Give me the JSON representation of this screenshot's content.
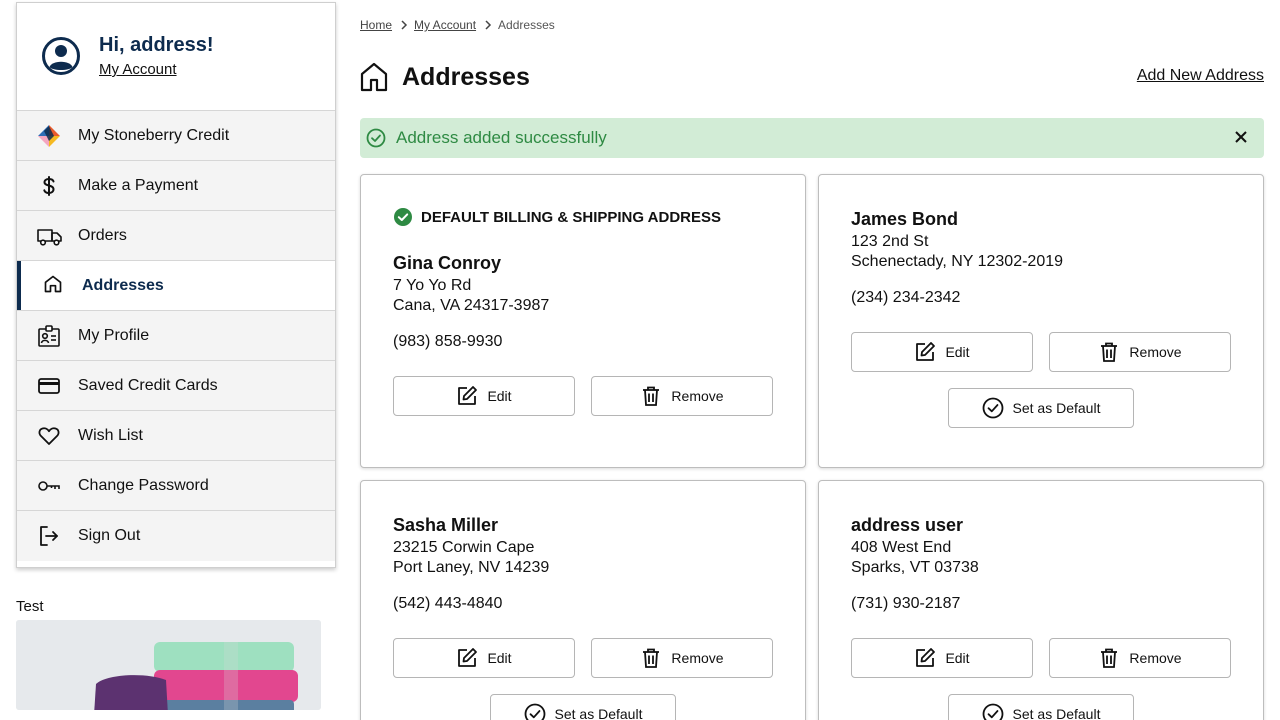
{
  "sidebar": {
    "greeting": "Hi, address!",
    "account_link": "My Account",
    "items": [
      {
        "label": "My Stoneberry Credit",
        "icon": "stoneberry-logo-icon"
      },
      {
        "label": "Make a Payment",
        "icon": "dollar-icon"
      },
      {
        "label": "Orders",
        "icon": "truck-icon"
      },
      {
        "label": "Addresses",
        "icon": "home-icon",
        "active": true
      },
      {
        "label": "My Profile",
        "icon": "id-badge-icon"
      },
      {
        "label": "Saved Credit Cards",
        "icon": "credit-card-icon"
      },
      {
        "label": "Wish List",
        "icon": "heart-icon"
      },
      {
        "label": "Change Password",
        "icon": "key-icon"
      },
      {
        "label": "Sign Out",
        "icon": "sign-out-icon"
      }
    ],
    "promo_title": "Test"
  },
  "breadcrumb": {
    "home": "Home",
    "account": "My Account",
    "current": "Addresses"
  },
  "page": {
    "title": "Addresses",
    "add_new": "Add New Address"
  },
  "alert": {
    "message": "Address added successfully"
  },
  "default_label": "DEFAULT BILLING & SHIPPING ADDRESS",
  "buttons": {
    "edit": "Edit",
    "remove": "Remove",
    "set_default": "Set as Default"
  },
  "addresses": [
    {
      "name": "Gina Conroy",
      "street": "7 Yo Yo Rd",
      "city": "Cana, VA 24317-3987",
      "phone": "(983) 858-9930",
      "is_default": true
    },
    {
      "name": "James Bond",
      "street": "123 2nd St",
      "city": "Schenectady, NY 12302-2019",
      "phone": "(234) 234-2342",
      "is_default": false
    },
    {
      "name": "Sasha Miller",
      "street": "23215 Corwin Cape",
      "city": "Port Laney, NV 14239",
      "phone": "(542) 443-4840",
      "is_default": false
    },
    {
      "name": "address user",
      "street": "408 West End",
      "city": "Sparks, VT 03738",
      "phone": "(731) 930-2187",
      "is_default": false
    }
  ],
  "colors": {
    "brand_navy": "#0d2b4e",
    "success_bg": "#d2ecd6",
    "success_text": "#2e8a43"
  }
}
